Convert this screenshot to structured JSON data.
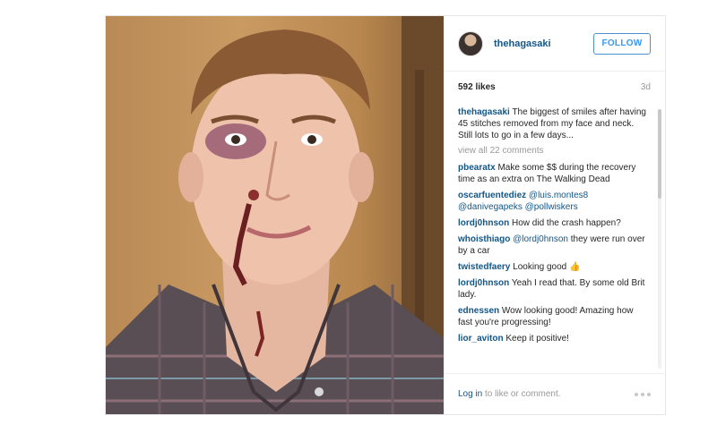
{
  "post": {
    "username": "thehagasaki",
    "follow_label": "FOLLOW",
    "likes": "592 likes",
    "time_ago": "3d",
    "caption": {
      "user": "thehagasaki",
      "text": "The biggest of smiles after having 45 stitches removed from my face and neck. Still lots to go in a few days..."
    },
    "view_all_label": "view all 22 comments",
    "comments": [
      {
        "user": "pbearatx",
        "text": "Make some $$ during the recovery time as an extra on The Walking Dead"
      },
      {
        "user": "oscarfuentediez",
        "mentions": "@luis.montes8 @danivegapeks @pollwiskers"
      },
      {
        "user": "lordj0hnson",
        "text": "How did the crash happen?"
      },
      {
        "user": "whoisthiago",
        "mention": "@lordj0hnson",
        "text": "they were run over by a car"
      },
      {
        "user": "twistedfaery",
        "text": "Looking good",
        "emoji": "👍"
      },
      {
        "user": "lordj0hnson",
        "text": "Yeah I read that. By some old Brit lady."
      },
      {
        "user": "ednessen",
        "text": "Wow looking good! Amazing how fast you're progressing!"
      },
      {
        "user": "lior_aviton",
        "text": "Keep it positive!"
      }
    ],
    "footer": {
      "login_link": "Log in",
      "login_rest": " to like or comment."
    }
  },
  "icons": {
    "more": "more-options-icon"
  },
  "colors": {
    "username_blue": "#125688",
    "follow_blue": "#3897f0",
    "muted": "#999999"
  }
}
